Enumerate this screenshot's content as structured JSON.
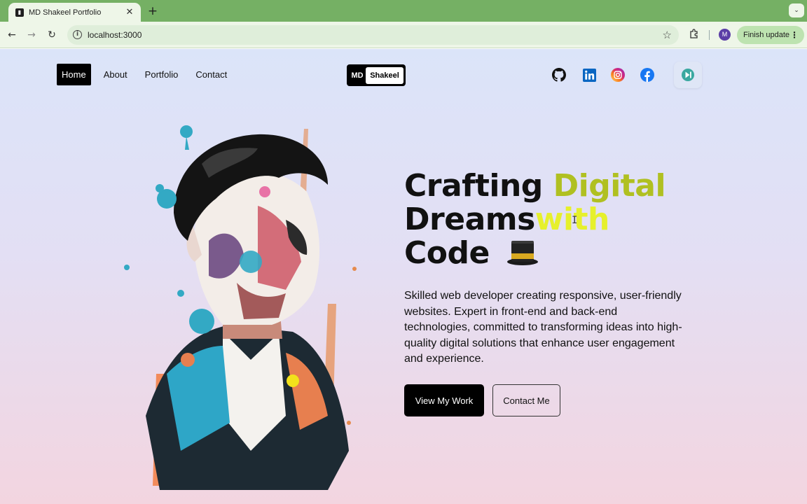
{
  "browser": {
    "tab_title": "MD Shakeel Portfolio",
    "tab_favicon_text": "▮",
    "tab_close": "✕",
    "new_tab": "+",
    "tab_menu": "⌄",
    "url": "localhost:3000",
    "back": "←",
    "forward": "→",
    "reload": "↻",
    "info": "i",
    "star": "☆",
    "extensions": "⧉",
    "profile_initial": "M",
    "finish_update": "Finish update",
    "menu_dots": "⋮"
  },
  "nav": {
    "links": [
      "Home",
      "About",
      "Portfolio",
      "Contact"
    ],
    "active": "Home"
  },
  "logo": {
    "short": "MD",
    "name": "Shakeel"
  },
  "social": [
    {
      "name": "github-icon",
      "color": "#111111"
    },
    {
      "name": "linkedin-icon",
      "color": "#0a66c2"
    },
    {
      "name": "instagram-icon",
      "color": "#d62976"
    },
    {
      "name": "facebook-icon",
      "color": "#1877f2"
    }
  ],
  "hero": {
    "headline_line1_a": "Crafting",
    "headline_line1_b": "Digital",
    "headline_line2_a": "Dreams",
    "headline_line2_b": "with",
    "headline_line3": "Code",
    "accent1": "#b0c021",
    "accent2": "#e6f02c",
    "description": "Skilled web developer creating responsive, user-friendly websites. Expert in front-end and back-end technologies, committed to transforming ideas into high-quality digital solutions that enhance user engagement and experience.",
    "primary_button": "View My Work",
    "secondary_button": "Contact Me"
  }
}
